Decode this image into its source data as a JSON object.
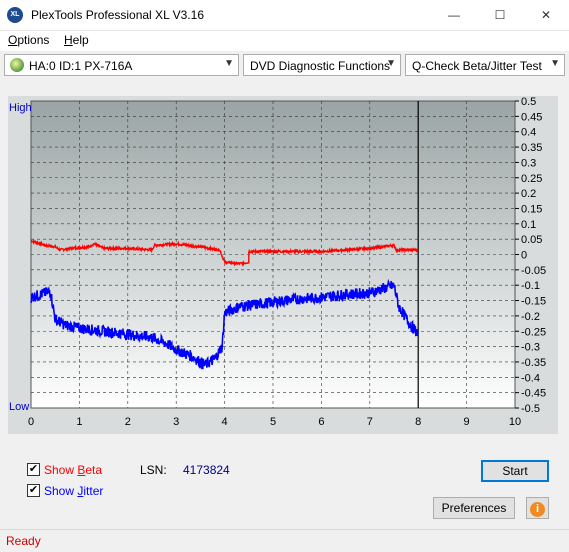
{
  "window": {
    "title": "PlexTools Professional XL V3.16",
    "app_icon_text": "XL",
    "minimize": "—",
    "maximize": "☐",
    "close": "✕"
  },
  "menu": [
    {
      "label": "Options",
      "hotkey": "O",
      "rest": "ptions"
    },
    {
      "label": "Help",
      "hotkey": "H",
      "rest": "elp"
    }
  ],
  "toolbar": {
    "drive": "HA:0 ID:1  PX-716A",
    "function": "DVD Diagnostic Functions",
    "test": "Q-Check Beta/Jitter Test"
  },
  "chart_data": {
    "type": "line",
    "left_axis_top_label": "High",
    "left_axis_bottom_label": "Low",
    "x_ticks": [
      "0",
      "1",
      "2",
      "3",
      "4",
      "5",
      "6",
      "7",
      "8",
      "9",
      "10"
    ],
    "y_ticks": [
      "0.5",
      "0.45",
      "0.4",
      "0.35",
      "0.3",
      "0.25",
      "0.2",
      "0.15",
      "0.1",
      "0.05",
      "0",
      "-0.05",
      "-0.1",
      "-0.15",
      "-0.2",
      "-0.25",
      "-0.3",
      "-0.35",
      "-0.4",
      "-0.45",
      "-0.5"
    ],
    "xlim": [
      0,
      10
    ],
    "ylim": [
      -0.5,
      0.5
    ],
    "end_marker_x": 8.0,
    "series": [
      {
        "id": "beta",
        "color": "#ff0000",
        "points": [
          [
            0,
            0.045
          ],
          [
            0.3,
            0.03
          ],
          [
            0.5,
            0.025
          ],
          [
            0.6,
            0.015
          ],
          [
            0.8,
            0.02
          ],
          [
            1.2,
            0.025
          ],
          [
            1.3,
            0.035
          ],
          [
            1.5,
            0.02
          ],
          [
            2.0,
            0.02
          ],
          [
            2.5,
            0.015
          ],
          [
            2.55,
            0.03
          ],
          [
            3.0,
            0.035
          ],
          [
            3.5,
            0.025
          ],
          [
            3.9,
            0.015
          ],
          [
            4.0,
            -0.025
          ],
          [
            4.3,
            -0.03
          ],
          [
            4.5,
            -0.025
          ],
          [
            4.5,
            0.01
          ],
          [
            5.0,
            0.01
          ],
          [
            6.0,
            0.01
          ],
          [
            7.0,
            0.02
          ],
          [
            7.5,
            0.03
          ],
          [
            7.55,
            0.015
          ],
          [
            8.0,
            0.015
          ]
        ]
      },
      {
        "id": "jitter",
        "color": "#0000ff",
        "points": [
          [
            0,
            -0.14
          ],
          [
            0.2,
            -0.13
          ],
          [
            0.4,
            -0.12
          ],
          [
            0.5,
            -0.21
          ],
          [
            0.7,
            -0.23
          ],
          [
            1.0,
            -0.24
          ],
          [
            1.5,
            -0.25
          ],
          [
            2.0,
            -0.26
          ],
          [
            2.5,
            -0.27
          ],
          [
            2.8,
            -0.29
          ],
          [
            3.0,
            -0.31
          ],
          [
            3.3,
            -0.33
          ],
          [
            3.6,
            -0.36
          ],
          [
            3.8,
            -0.34
          ],
          [
            3.95,
            -0.3
          ],
          [
            4.0,
            -0.19
          ],
          [
            4.3,
            -0.17
          ],
          [
            4.8,
            -0.16
          ],
          [
            5.0,
            -0.155
          ],
          [
            5.5,
            -0.145
          ],
          [
            6.0,
            -0.14
          ],
          [
            6.5,
            -0.13
          ],
          [
            7.0,
            -0.125
          ],
          [
            7.5,
            -0.1
          ],
          [
            7.6,
            -0.17
          ],
          [
            7.8,
            -0.22
          ],
          [
            8.0,
            -0.26
          ]
        ]
      }
    ]
  },
  "controls": {
    "show_beta": {
      "checked": true,
      "label_pre": "Show ",
      "label_hot": "B",
      "label_post": "eta",
      "color": "#ff0000"
    },
    "show_jitter": {
      "checked": true,
      "label_pre": "Show ",
      "label_hot": "J",
      "label_post": "itter",
      "color": "#0000ff"
    },
    "lsn_label": "LSN:",
    "lsn_value": "4173824",
    "start_button": "Start",
    "preferences_button": "Preferences",
    "info_icon": "i"
  },
  "status": {
    "text": "Ready"
  }
}
